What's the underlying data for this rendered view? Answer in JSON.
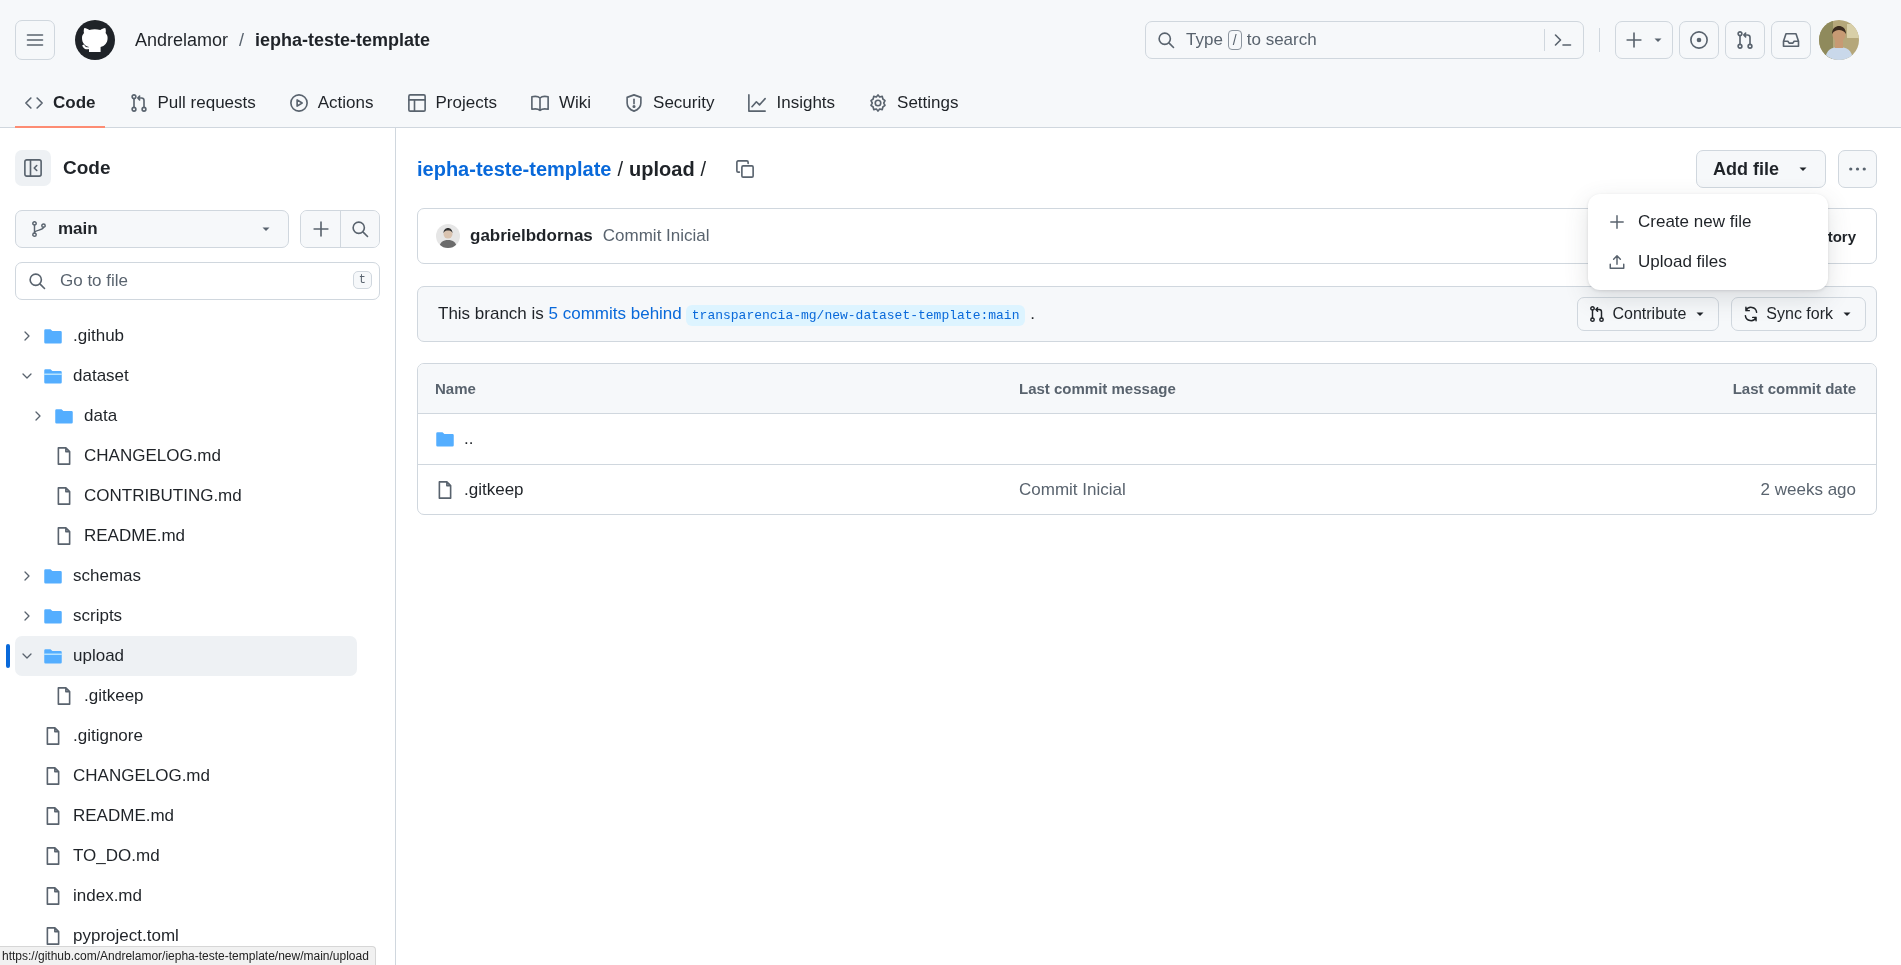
{
  "header": {
    "owner": "Andrelamor",
    "separator": "/",
    "repo": "iepha-teste-template",
    "search": {
      "before_key": "Type",
      "key": "/",
      "after_key": "to search"
    }
  },
  "tabs": [
    {
      "label": "Code",
      "kind": "code",
      "selected": true
    },
    {
      "label": "Pull requests",
      "kind": "pulls",
      "selected": false
    },
    {
      "label": "Actions",
      "kind": "actions",
      "selected": false
    },
    {
      "label": "Projects",
      "kind": "projects",
      "selected": false
    },
    {
      "label": "Wiki",
      "kind": "wiki",
      "selected": false
    },
    {
      "label": "Security",
      "kind": "security",
      "selected": false
    },
    {
      "label": "Insights",
      "kind": "insights",
      "selected": false
    },
    {
      "label": "Settings",
      "kind": "settings",
      "selected": false
    }
  ],
  "sidebar": {
    "title": "Code",
    "branch": "main",
    "filter": {
      "placeholder": "Go to file",
      "shortcut": "t"
    },
    "tree": [
      {
        "name": ".github",
        "kind": "folder",
        "expanded": false,
        "selected": false
      },
      {
        "name": "dataset",
        "kind": "folder",
        "expanded": true,
        "selected": false,
        "children": [
          {
            "name": "data",
            "kind": "folder",
            "expanded": false,
            "selected": false
          },
          {
            "name": "CHANGELOG.md",
            "kind": "file",
            "selected": false
          },
          {
            "name": "CONTRIBUTING.md",
            "kind": "file",
            "selected": false
          },
          {
            "name": "README.md",
            "kind": "file",
            "selected": false
          }
        ]
      },
      {
        "name": "schemas",
        "kind": "folder",
        "expanded": false,
        "selected": false
      },
      {
        "name": "scripts",
        "kind": "folder",
        "expanded": false,
        "selected": false
      },
      {
        "name": "upload",
        "kind": "folder",
        "expanded": true,
        "selected": true,
        "children": [
          {
            "name": ".gitkeep",
            "kind": "file",
            "selected": false
          }
        ]
      },
      {
        "name": ".gitignore",
        "kind": "file",
        "selected": false
      },
      {
        "name": "CHANGELOG.md",
        "kind": "file",
        "selected": false
      },
      {
        "name": "README.md",
        "kind": "file",
        "selected": false
      },
      {
        "name": "TO_DO.md",
        "kind": "file",
        "selected": false
      },
      {
        "name": "index.md",
        "kind": "file",
        "selected": false
      },
      {
        "name": "pyproject.toml",
        "kind": "file",
        "selected": false
      }
    ]
  },
  "breadcrumb": [
    {
      "text": "iepha-teste-template",
      "kind": "link"
    },
    {
      "text": "/",
      "kind": "separator"
    },
    {
      "text": "upload",
      "kind": "current"
    },
    {
      "text": "/",
      "kind": "separator"
    }
  ],
  "add_file": "Add file",
  "commit": {
    "author": "gabrielbdornas",
    "message": "Commit Inicial",
    "history": "tory"
  },
  "fork_banner": {
    "text": "This branch is",
    "link": "5 commits behind",
    "upstream": "transparencia-mg/new-dataset-template:main",
    "end": ".",
    "buttons": [
      {
        "label": "Contribute",
        "kind": "contribute"
      },
      {
        "label": "Sync fork",
        "kind": "sync"
      }
    ]
  },
  "table": {
    "columns": [
      "Name",
      "Last commit message",
      "Last commit date"
    ],
    "rows": [
      {
        "kind": "parent",
        "name": ".."
      },
      {
        "kind": "file",
        "name": ".gitkeep",
        "message": "Commit Inicial",
        "date": "2 weeks ago"
      }
    ]
  },
  "menu": {
    "items": [
      {
        "label": "Create new file",
        "kind": "create"
      },
      {
        "label": "Upload files",
        "kind": "upload"
      }
    ]
  },
  "status_url": "https://github.com/Andrelamor/iepha-teste-template/new/main/upload"
}
